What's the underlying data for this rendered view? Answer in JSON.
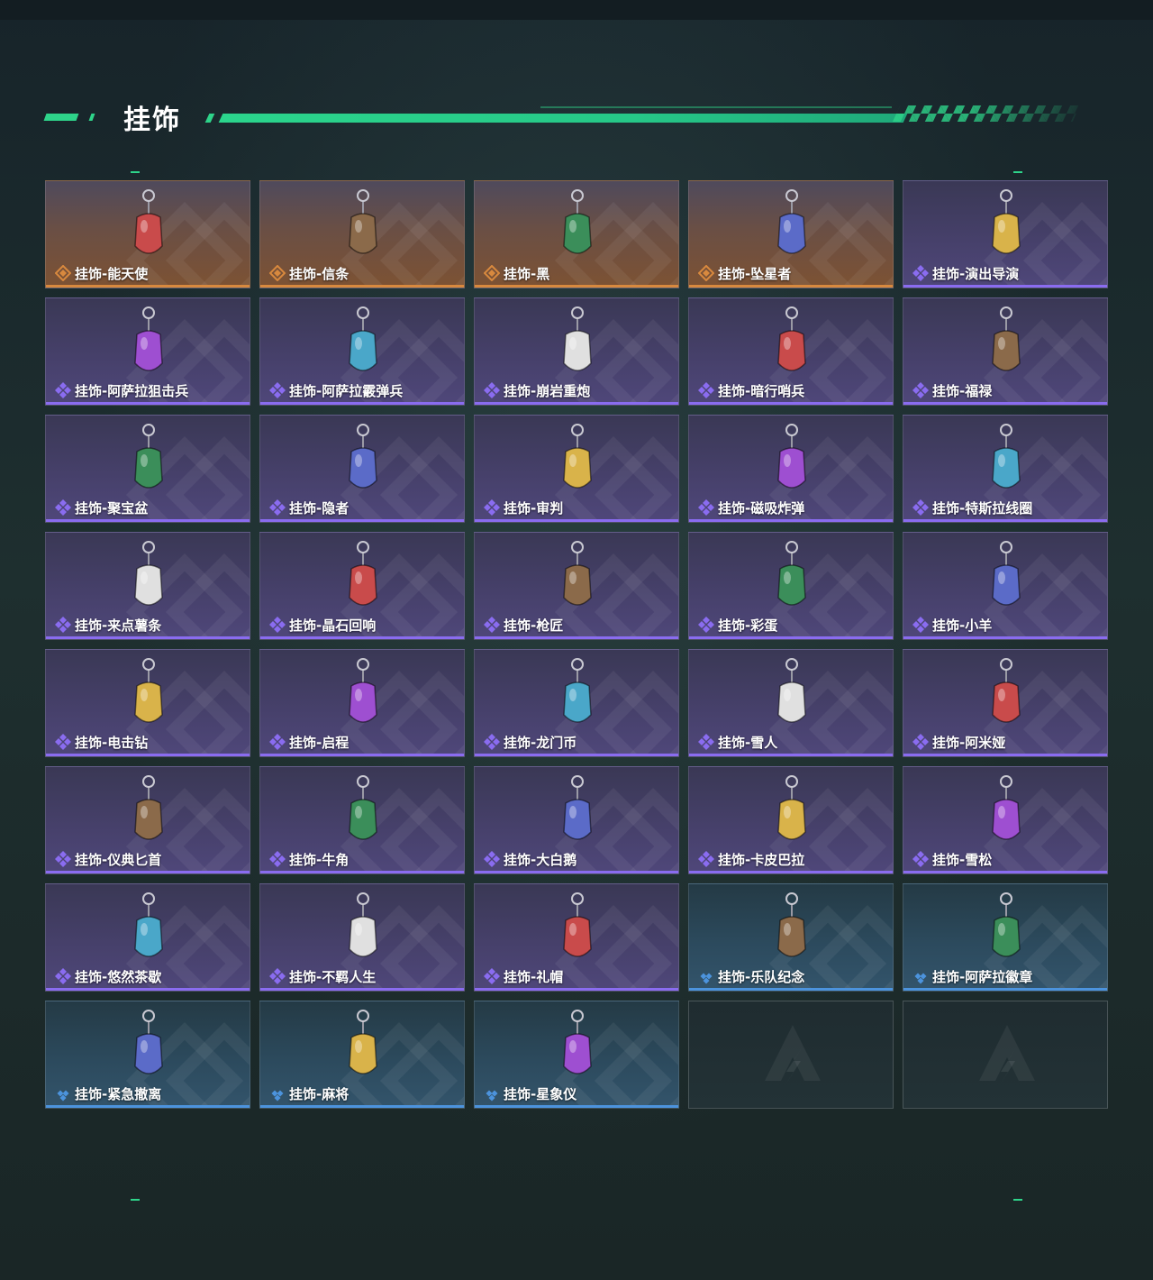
{
  "header": {
    "title": "挂饰"
  },
  "colors": {
    "accent": "#2ed48a",
    "gold": "#d8893e",
    "purple": "#8a6cf0",
    "blue": "#4c93dd"
  },
  "items": [
    {
      "label": "挂饰-能天使",
      "rarity": "gold"
    },
    {
      "label": "挂饰-信条",
      "rarity": "gold"
    },
    {
      "label": "挂饰-黑",
      "rarity": "gold"
    },
    {
      "label": "挂饰-坠星者",
      "rarity": "gold"
    },
    {
      "label": "挂饰-演出导演",
      "rarity": "purple"
    },
    {
      "label": "挂饰-阿萨拉狙击兵",
      "rarity": "purple"
    },
    {
      "label": "挂饰-阿萨拉霰弹兵",
      "rarity": "purple"
    },
    {
      "label": "挂饰-崩岩重炮",
      "rarity": "purple"
    },
    {
      "label": "挂饰-暗行哨兵",
      "rarity": "purple"
    },
    {
      "label": "挂饰-福禄",
      "rarity": "purple"
    },
    {
      "label": "挂饰-聚宝盆",
      "rarity": "purple"
    },
    {
      "label": "挂饰-隐者",
      "rarity": "purple"
    },
    {
      "label": "挂饰-审判",
      "rarity": "purple"
    },
    {
      "label": "挂饰-磁吸炸弹",
      "rarity": "purple"
    },
    {
      "label": "挂饰-特斯拉线圈",
      "rarity": "purple"
    },
    {
      "label": "挂饰-来点薯条",
      "rarity": "purple"
    },
    {
      "label": "挂饰-晶石回响",
      "rarity": "purple"
    },
    {
      "label": "挂饰-枪匠",
      "rarity": "purple"
    },
    {
      "label": "挂饰-彩蛋",
      "rarity": "purple"
    },
    {
      "label": "挂饰-小羊",
      "rarity": "purple"
    },
    {
      "label": "挂饰-电击钻",
      "rarity": "purple"
    },
    {
      "label": "挂饰-启程",
      "rarity": "purple"
    },
    {
      "label": "挂饰-龙门币",
      "rarity": "purple"
    },
    {
      "label": "挂饰-雪人",
      "rarity": "purple"
    },
    {
      "label": "挂饰-阿米娅",
      "rarity": "purple"
    },
    {
      "label": "挂饰-仪典匕首",
      "rarity": "purple"
    },
    {
      "label": "挂饰-牛角",
      "rarity": "purple"
    },
    {
      "label": "挂饰-大白鹅",
      "rarity": "purple"
    },
    {
      "label": "挂饰-卡皮巴拉",
      "rarity": "purple"
    },
    {
      "label": "挂饰-雪松",
      "rarity": "purple"
    },
    {
      "label": "挂饰-悠然茶歇",
      "rarity": "purple"
    },
    {
      "label": "挂饰-不羁人生",
      "rarity": "purple"
    },
    {
      "label": "挂饰-礼帽",
      "rarity": "purple"
    },
    {
      "label": "挂饰-乐队纪念",
      "rarity": "blue"
    },
    {
      "label": "挂饰-阿萨拉徽章",
      "rarity": "blue"
    },
    {
      "label": "挂饰-紧急撤离",
      "rarity": "blue"
    },
    {
      "label": "挂饰-麻将",
      "rarity": "blue"
    },
    {
      "label": "挂饰-星象仪",
      "rarity": "blue"
    }
  ],
  "empty_slots": 2
}
